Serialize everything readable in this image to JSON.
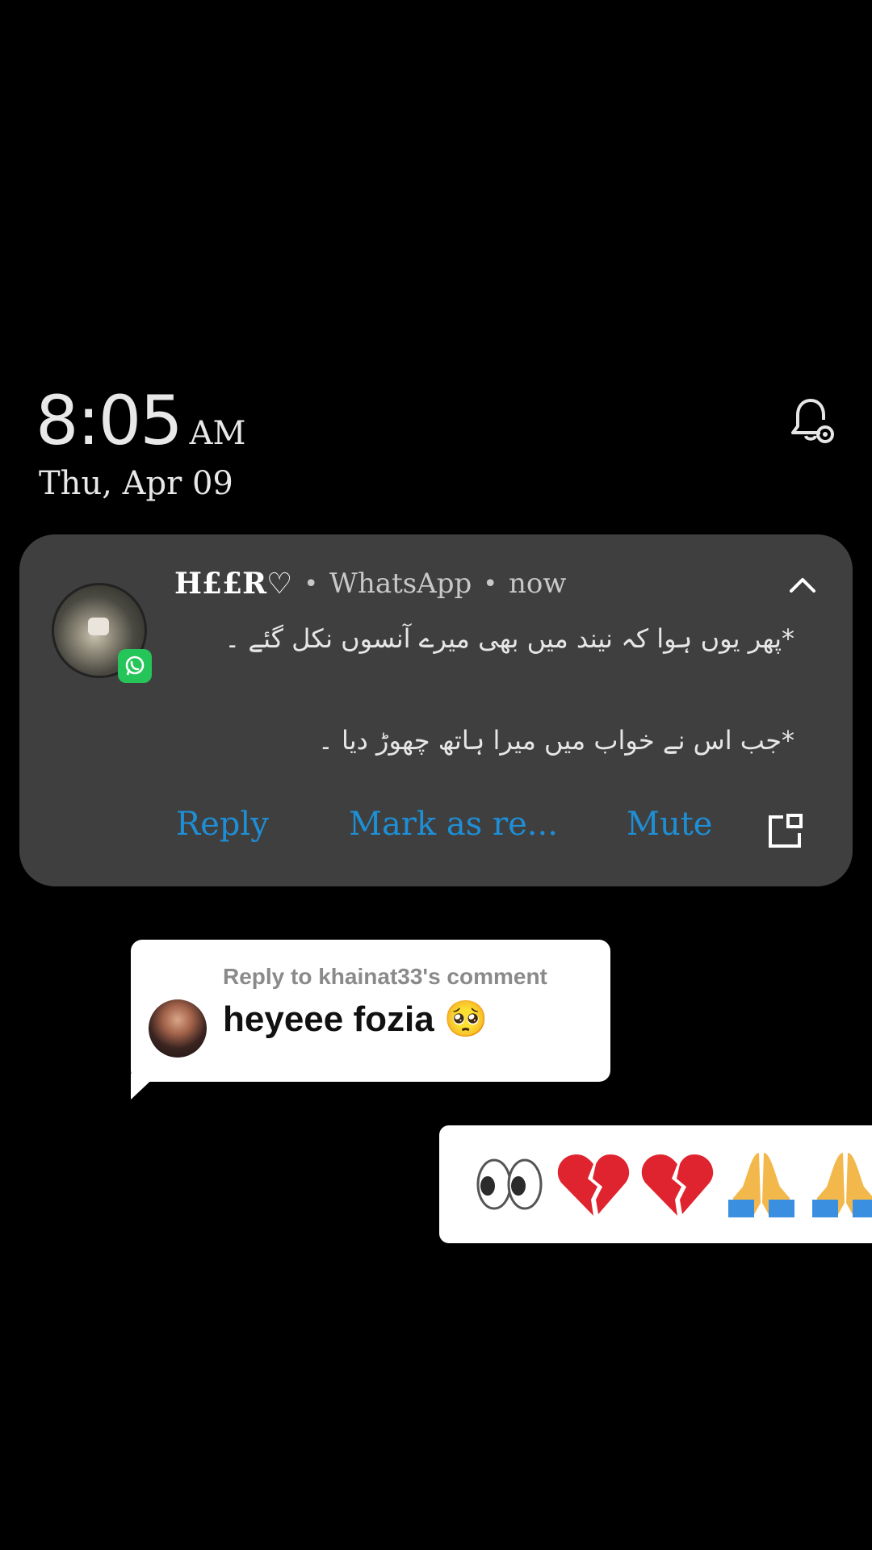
{
  "lockscreen": {
    "time": "8:05",
    "ampm": "AM",
    "date": "Thu, Apr 09"
  },
  "notification": {
    "sender": "H££R♡",
    "app": "WhatsApp",
    "when": "now",
    "message_line1": "*پھر یوں ہوا کہ نیند میں بھی میرے آنسوں نکل گئے ۔",
    "message_line2": "*جب اس نے خواب میں  میرا ہاتھ چھوڑ دیا ۔",
    "actions": {
      "reply": "Reply",
      "mark_read": "Mark as re...",
      "mute": "Mute"
    }
  },
  "comment_reply": {
    "reply_to": "Reply to khainat33's comment",
    "text": "heyeee fozia 🥺"
  },
  "emoji_bubble": {
    "emojis": [
      "eyes",
      "broken-heart",
      "broken-heart",
      "folded-hands",
      "folded-hands"
    ]
  },
  "colors": {
    "background": "#000000",
    "card": "#3f3f3f",
    "action_blue": "#1e8fd6",
    "whatsapp_green": "#25c55a"
  }
}
